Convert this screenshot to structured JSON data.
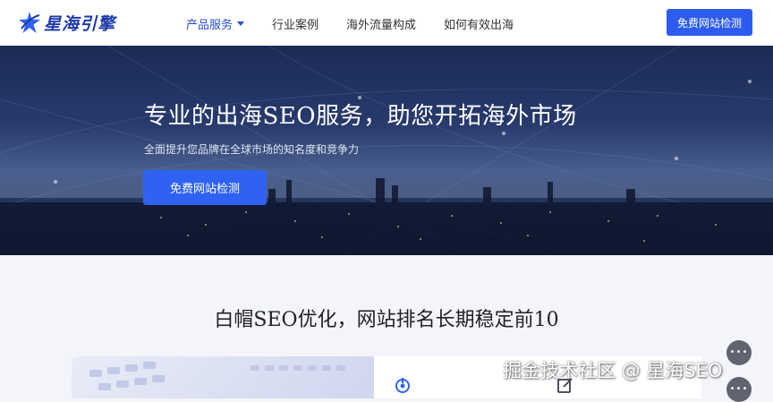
{
  "header": {
    "logo_text": "星海引擎",
    "nav": [
      {
        "label": "产品服务",
        "has_dropdown": true,
        "active": true
      },
      {
        "label": "行业案例"
      },
      {
        "label": "海外流量构成"
      },
      {
        "label": "如何有效出海"
      }
    ],
    "cta_label": "免费网站检测"
  },
  "hero": {
    "title": "专业的出海SEO服务，助您开拓海外市场",
    "subtitle": "全面提升您品牌在全球市场的知名度和竞争力",
    "cta_label": "免费网站检测"
  },
  "section": {
    "title": "白帽SEO优化，网站排名长期稳定前10"
  },
  "icons": [
    "logo-star-icon",
    "chevron-down-icon",
    "target-icon",
    "edit-icon",
    "chat-icon"
  ],
  "watermark": "掘金技术社区 @ 星海SEO",
  "colors": {
    "brand": "#1f3aa8",
    "accent": "#2d5bf0",
    "hero_bg": "#27396b",
    "page_bg": "#f3f5fb"
  }
}
